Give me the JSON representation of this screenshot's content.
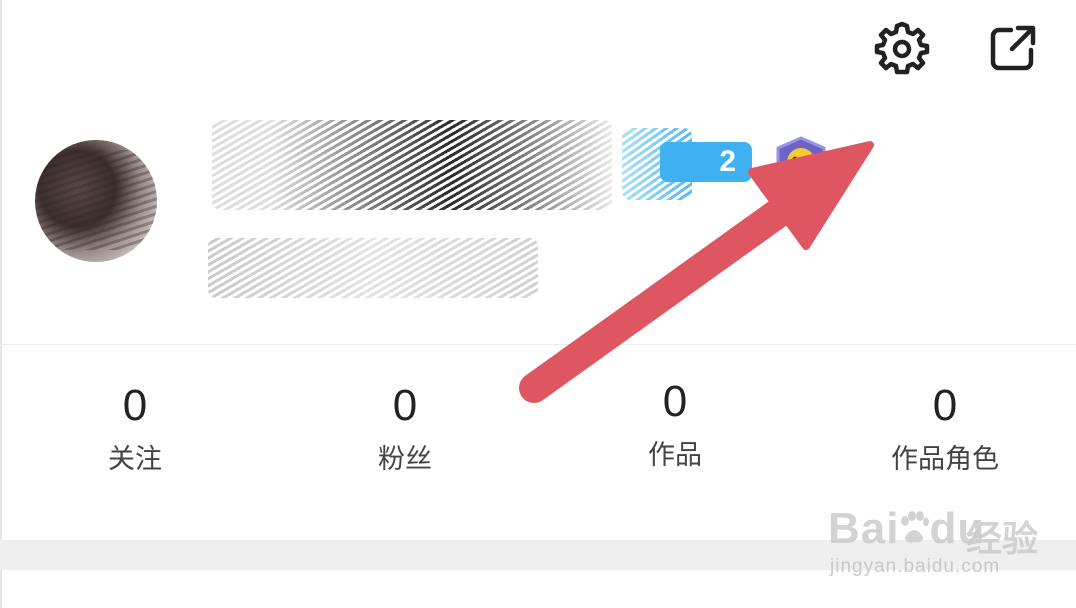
{
  "header": {
    "settings_icon": "gear-icon",
    "share_icon": "external-link-icon"
  },
  "profile": {
    "level_badge": "2",
    "accent": "#3fb1f1"
  },
  "stats": [
    {
      "value": "0",
      "label": "关注"
    },
    {
      "value": "0",
      "label": "粉丝"
    },
    {
      "value": "0",
      "label": "作品"
    },
    {
      "value": "0",
      "label": "作品角色"
    }
  ],
  "watermark": {
    "logo": "Bai",
    "logo_tail": "du",
    "brand_cn": "经验",
    "url": "jingyan.baidu.com"
  },
  "annotation": {
    "arrow_color": "#de5661"
  }
}
